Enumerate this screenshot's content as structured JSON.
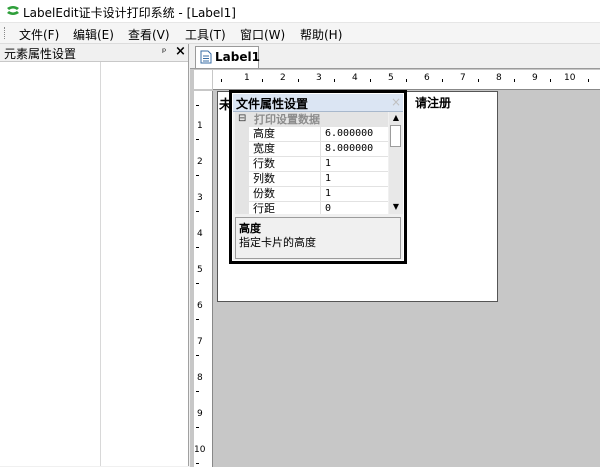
{
  "app": {
    "title": "LabelEdit证卡设计打印系统 - [Label1]",
    "logo_icon": "labeledit-logo-icon",
    "logo_color": "#2e9f3a"
  },
  "menu": [
    {
      "label": "文件(F)"
    },
    {
      "label": "编辑(E)"
    },
    {
      "label": "查看(V)"
    },
    {
      "label": "工具(T)"
    },
    {
      "label": "窗口(W)"
    },
    {
      "label": "帮助(H)"
    }
  ],
  "left_panel": {
    "title": "元素属性设置",
    "pin_icon": "pin-icon",
    "pin_glyph": "ᵖ",
    "close_icon": "close-icon",
    "close_glyph": "×"
  },
  "doc_tab": {
    "label": "Label1",
    "icon": "document-icon"
  },
  "ruler": {
    "horizontal": [
      "1",
      "2",
      "3",
      "4",
      "5",
      "6",
      "7",
      "8",
      "9",
      "10"
    ],
    "vertical": [
      "1",
      "2",
      "3",
      "4",
      "5",
      "6",
      "7",
      "8",
      "9",
      "10"
    ]
  },
  "card": {
    "text_left": "未",
    "text_right": "请注册"
  },
  "dialog": {
    "title": "文件属性设置",
    "close_glyph": "×",
    "category": {
      "toggle": "⊟",
      "label": "打印设置数据"
    },
    "rows": [
      {
        "name": "高度",
        "value": "6.000000"
      },
      {
        "name": "宽度",
        "value": "8.000000"
      },
      {
        "name": "行数",
        "value": "1"
      },
      {
        "name": "列数",
        "value": "1"
      },
      {
        "name": "份数",
        "value": "1"
      },
      {
        "name": "行距",
        "value": "0"
      }
    ],
    "scroll_up_glyph": "▲",
    "scroll_down_glyph": "▼",
    "description": {
      "title": "高度",
      "text": "指定卡片的高度"
    }
  },
  "colors": {
    "canvas_bg": "#c7c7c7",
    "dialog_title_bg": "#dbe5f3",
    "grid_category_text": "#8c8c8c"
  }
}
